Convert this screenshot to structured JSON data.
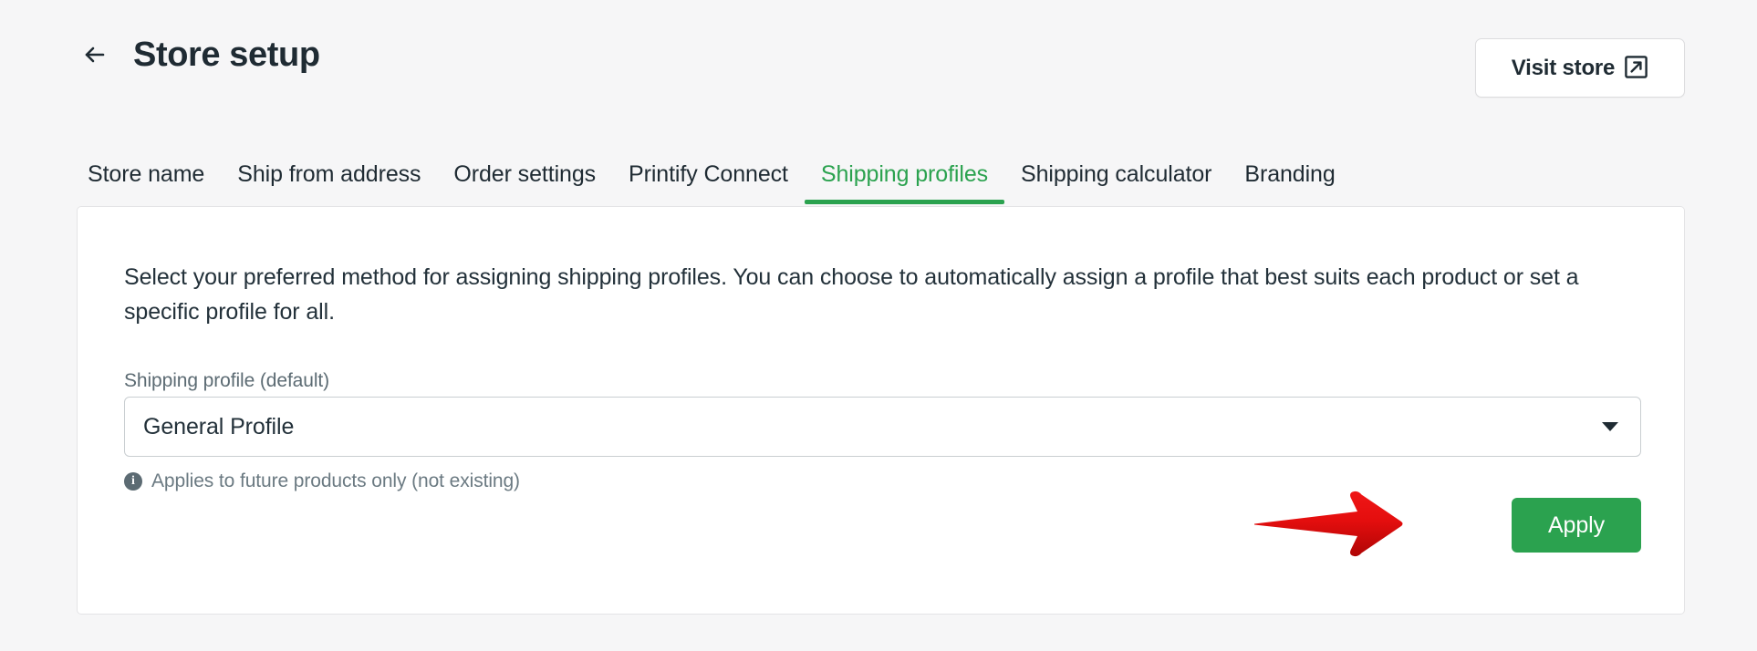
{
  "header": {
    "back_icon": "arrow-left-icon",
    "title": "Store setup",
    "visit_store_label": "Visit store",
    "visit_store_icon": "external-link-icon"
  },
  "tabs": [
    {
      "label": "Store name",
      "active": false
    },
    {
      "label": "Ship from address",
      "active": false
    },
    {
      "label": "Order settings",
      "active": false
    },
    {
      "label": "Printify Connect",
      "active": false
    },
    {
      "label": "Shipping profiles",
      "active": true
    },
    {
      "label": "Shipping calculator",
      "active": false
    },
    {
      "label": "Branding",
      "active": false
    }
  ],
  "card": {
    "description": "Select your preferred method for assigning shipping profiles. You can choose to automatically assign a profile that best suits each product or set a specific profile for all.",
    "field_label": "Shipping profile (default)",
    "select_value": "General Profile",
    "select_caret_icon": "chevron-down-icon",
    "hint_icon": "info-icon",
    "hint_text": "Applies to future products only (not existing)",
    "apply_label": "Apply"
  },
  "annotation": {
    "arrow_icon": "red-arrow-right-annotation"
  },
  "colors": {
    "accent_green": "#2ba24f",
    "page_background": "#f6f6f7",
    "card_background": "#ffffff",
    "text_primary": "#23313a",
    "text_muted": "#6b7a82",
    "annotation_red": "#e01010"
  }
}
